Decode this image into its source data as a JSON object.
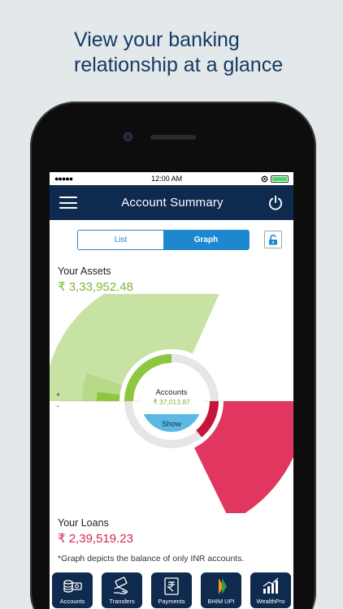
{
  "headline": {
    "line1": "View your banking",
    "line2": "relationship at a glance"
  },
  "status_bar": {
    "signal": "●●●●●",
    "time": "12:00 AM"
  },
  "header": {
    "title": "Account Summary"
  },
  "segment": {
    "list_label": "List",
    "graph_label": "Graph",
    "selected": "Graph"
  },
  "assets": {
    "label": "Your Assets",
    "value": "₹ 3,33,952.48"
  },
  "chart_data": {
    "type": "radial",
    "center_label": "Accounts",
    "center_value": "₹ 37,013.87",
    "center_button": "Show",
    "plus_label": "+",
    "minus_label": "-",
    "colors": {
      "assets_light": "#c8e2a3",
      "assets_mid": "#b6d98a",
      "assets_dark": "#8dc63f",
      "loans": "#e0365f",
      "loans_dark": "#c4163c",
      "ring": "#e6e6e6",
      "button": "#5bb9e4"
    }
  },
  "loans": {
    "label": "Your Loans",
    "value": "₹ 2,39,519.23"
  },
  "footnote": "*Graph depicts the balance of only INR accounts.",
  "tabs": [
    {
      "label": "Accounts",
      "icon": "accounts-icon"
    },
    {
      "label": "Transfers",
      "icon": "transfers-icon"
    },
    {
      "label": "Payments",
      "icon": "payments-icon"
    },
    {
      "label": "BHIM UPI",
      "icon": "bhim-upi-icon"
    },
    {
      "label": "WealthPro",
      "icon": "wealthpro-icon"
    }
  ]
}
